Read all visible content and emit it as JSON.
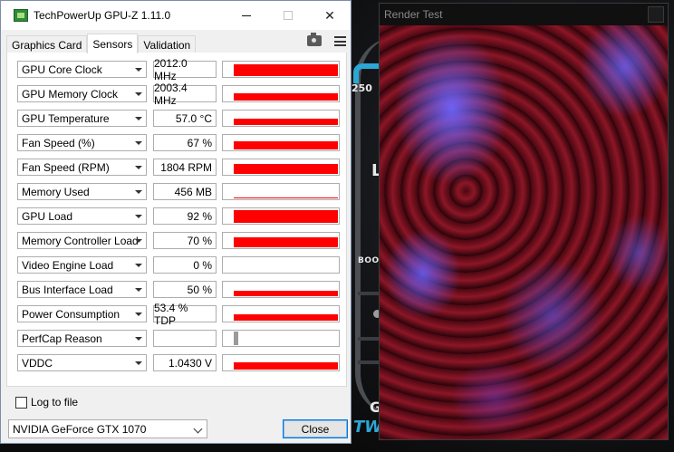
{
  "gpuz": {
    "title": "TechPowerUp GPU-Z 1.11.0",
    "tabs": [
      "Graphics Card",
      "Sensors",
      "Validation"
    ],
    "active_tab": "Sensors",
    "sensors": [
      {
        "name": "GPU Core Clock",
        "value": "2012.0 MHz",
        "level": 0.88
      },
      {
        "name": "GPU Memory Clock",
        "value": "2003.4 MHz",
        "level": 0.55
      },
      {
        "name": "GPU Temperature",
        "value": "57.0 °C",
        "level": 0.45
      },
      {
        "name": "Fan Speed (%)",
        "value": "67 %",
        "level": 0.6
      },
      {
        "name": "Fan Speed (RPM)",
        "value": "1804 RPM",
        "level": 0.75
      },
      {
        "name": "Memory Used",
        "value": "456 MB",
        "level": 0.08
      },
      {
        "name": "GPU Load",
        "value": "92 %",
        "level": 0.9
      },
      {
        "name": "Memory Controller Load",
        "value": "70 %",
        "level": 0.7
      },
      {
        "name": "Video Engine Load",
        "value": "0 %",
        "level": 0
      },
      {
        "name": "Bus Interface Load",
        "value": "50 %",
        "level": 0.4
      },
      {
        "name": "Power Consumption",
        "value": "53.4 % TDP",
        "level": 0.45
      },
      {
        "name": "PerfCap Reason",
        "value": "",
        "level": 1,
        "grey": true
      },
      {
        "name": "VDDC",
        "value": "1.0430 V",
        "level": 0.5
      }
    ],
    "log_to_file_label": "Log to file",
    "log_to_file_checked": false,
    "gpu_select_value": "NVIDIA GeForce GTX 1070",
    "close_label": "Close"
  },
  "render_test": {
    "title": "Render Test"
  },
  "background": {
    "text_250": "250",
    "text_boost": "BOOST",
    "text_g": "G",
    "text_tw": "TW",
    "text_l": "L"
  },
  "colors": {
    "graph": "#ff0000",
    "accent": "#0078d7"
  }
}
